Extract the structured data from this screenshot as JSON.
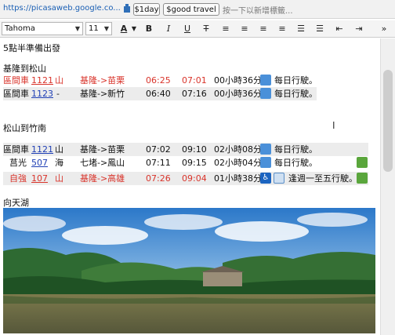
{
  "topbar": {
    "url": "https://picasaweb.google.co...",
    "tags": [
      "$1day",
      "$good travel"
    ],
    "hint": "按一下以新增標籤..."
  },
  "toolbar": {
    "font_family": "Tahoma",
    "font_size": "11"
  },
  "doc": {
    "heading": "5點半準備出發",
    "section1_title": "基隆到松山",
    "section1_rows": [
      {
        "type": "區間車",
        "num": "1121",
        "line": "山",
        "route": "基隆->苗栗",
        "dep": "06:25",
        "arr": "07:01",
        "dur": "00小時36分",
        "note": "每日行駛。"
      },
      {
        "type": "區間車",
        "num": "1123",
        "line": "-",
        "route": "基隆->新竹",
        "dep": "06:40",
        "arr": "07:16",
        "dur": "00小時36分",
        "note": "每日行駛。"
      }
    ],
    "section2_title": "松山到竹南",
    "section2_rows": [
      {
        "type": "區間車",
        "num": "1121",
        "line": "山",
        "route": "基隆->苗栗",
        "dep": "07:02",
        "arr": "09:10",
        "dur": "02小時08分",
        "note": "每日行駛。"
      },
      {
        "type": "莒光",
        "num": "507",
        "line": "海",
        "route": "七堵->鳳山",
        "dep": "07:11",
        "arr": "09:15",
        "dur": "02小時04分",
        "note": "每日行駛。"
      },
      {
        "type": "自強",
        "num": "107",
        "line": "山",
        "route": "基隆->高雄",
        "dep": "07:26",
        "arr": "09:04",
        "dur": "01小時38分",
        "note": "逢週一至五行駛。"
      }
    ],
    "section3_title": "向天湖"
  },
  "colors": {
    "red": "#d9342b",
    "link": "#1f3fb5",
    "shade": "#ececec"
  }
}
